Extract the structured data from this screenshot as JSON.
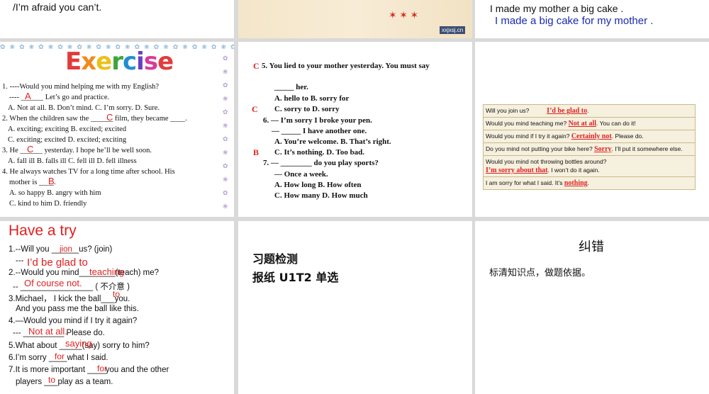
{
  "slide1": {
    "text": "/I’m afraid you can’t."
  },
  "slide2": {
    "watermark": "xxjxsj.cn"
  },
  "slide3": {
    "line1": "I made my mother  a big cake .",
    "line2": "I made a big cake for my mother ."
  },
  "slide4": {
    "title": "Exercise",
    "lines": [
      "1. ----Would you mind helping me with my English?",
      "----  ______ Let’s go and practice.",
      "A. Not at all.    B. Don’t mind.    C. I’m sorry.    D. Sure.",
      "2. When the children saw the ______ film, they became ____.",
      "A. exciting; exciting            B. excited; excited",
      "C. exciting; excited             D. excited; exciting",
      "3. He ______ yesterday. I hope he’ll be well soon.",
      "A. fall ill        B. falls ill        C. fell ill      D. fell illness",
      "4. He always watches TV for a long time after school. His",
      "mother is ____.",
      "A. so happy                          B. angry with him",
      "C. kind to him                      D. friendly"
    ],
    "answers": [
      "A",
      "C",
      "C",
      "B"
    ]
  },
  "slide5": {
    "lines": [
      "5. You lied to your mother yesterday. You  must say",
      "_____  her.",
      "A. hello to                B. sorry for",
      "C. sorry to                D. sorry",
      "6. — I’m sorry I broke your pen.",
      "— _____ I have another one.",
      "A. You’re welcome.                B. That’s right.",
      "C. It’s nothing.                    D. Too bad.",
      "7. — ________ do you play sports?",
      "—  Once a week.",
      "A. How long                           B. How often",
      "C. How many                          D. How much"
    ],
    "answers": [
      "C",
      "C",
      "B"
    ]
  },
  "slide6": {
    "rows": [
      {
        "pre": "Will you join us?",
        "fill": "I’d be glad  to",
        "post": "."
      },
      {
        "pre": "Would you mind teaching me?",
        "fill": "Not at all",
        "post": ". You can do it!"
      },
      {
        "pre": "Would you mind if I try it again?",
        "fill": "Certainly not",
        "post": ". Please do."
      },
      {
        "pre": "Do you mind not putting your bike here?",
        "fill": "Sorry",
        "post": ". I’ll put it somewhere else."
      },
      {
        "pre": "Would you mind not throwing bottles around?",
        "fill": "",
        "post": ""
      },
      {
        "pre": "",
        "fill": "I’m sorry about that",
        "post": ". I won’t do it again."
      },
      {
        "pre": "I am sorry for what I said.   It’s",
        "fill": "nothing",
        "post": "."
      }
    ]
  },
  "slide7": {
    "title": "Have a try",
    "q1": "1.--Will you ______us? (join)",
    "q1a": "---",
    "q2": "2.--Would you mind________(teach) me?",
    "q2a": "-- ________________ ( 不介意 )",
    "q3": "3.Michael，  I kick the ball___you.",
    "q3b": "And you pass  me the ball  like this.",
    "q4": "4.—Would you mind if I try  it again?",
    "q4a": "---  _________  Please do.",
    "q5": "5.What about _____(say) sorry to him?",
    "q6": "6.I’m sorry ____what I said.",
    "q7": "7.It is more important ____you and the other",
    "q7b": "players ___play as a team.",
    "answers": {
      "a1": "jion",
      "a1b": "I’d be glad to",
      "a2": "teaching",
      "a2b": "Of course not.",
      "a3": "to",
      "a4": "Not at all.",
      "a5": "saying",
      "a6": "for",
      "a7": "for",
      "a7b": "to"
    }
  },
  "slide8": {
    "line1": "习题检测",
    "line2": "报纸 U1T2 单选"
  },
  "slide9": {
    "title": "纠错",
    "text": "标清知识点，做题依据。"
  }
}
